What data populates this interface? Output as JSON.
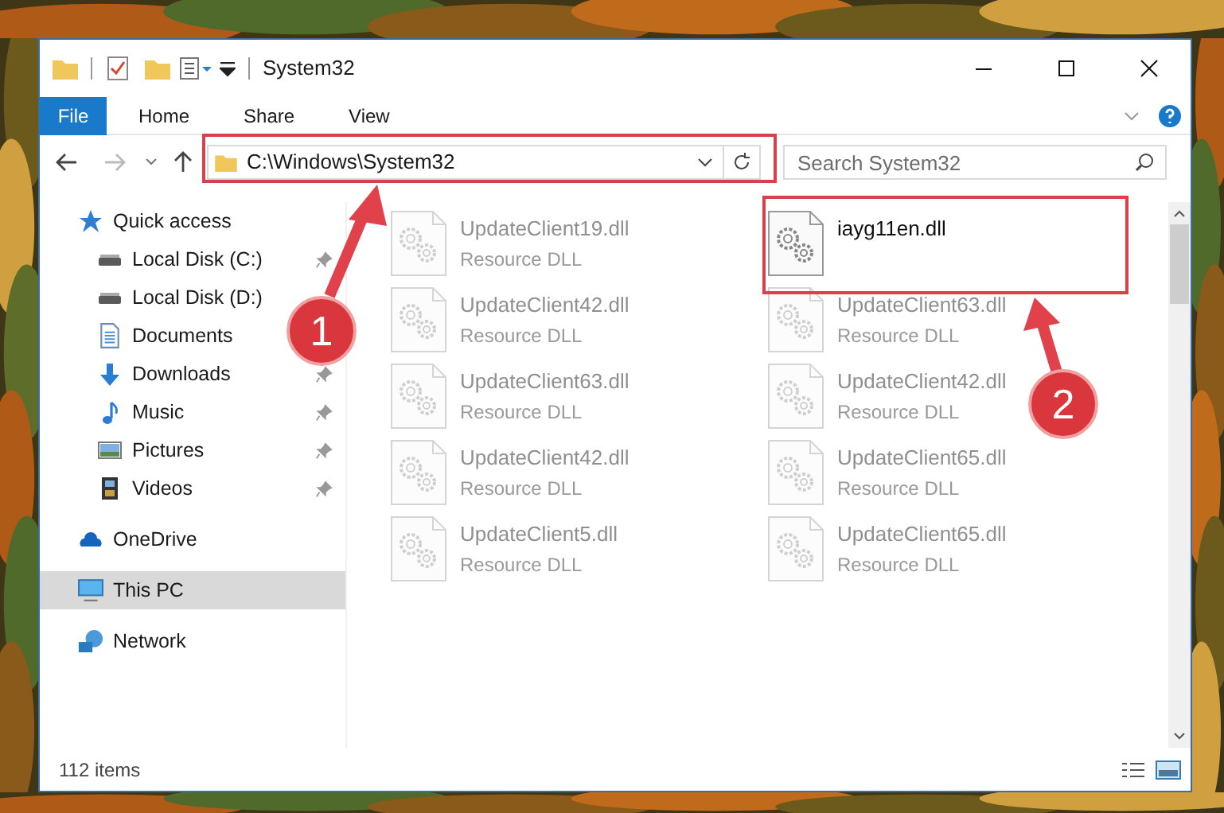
{
  "window": {
    "title": "System32"
  },
  "ribbon": {
    "file": "File",
    "tabs": [
      "Home",
      "Share",
      "View"
    ]
  },
  "address": {
    "path": "C:\\Windows\\System32"
  },
  "search": {
    "placeholder": "Search System32"
  },
  "nav": [
    {
      "label": "Quick access",
      "kind": "star",
      "selected": false,
      "children": [
        {
          "label": "Local Disk (C:)",
          "kind": "drive",
          "pinned": true,
          "selected": false
        },
        {
          "label": "Local Disk (D:)",
          "kind": "drive",
          "selected": false
        },
        {
          "label": "Documents",
          "kind": "documents",
          "selected": false
        },
        {
          "label": "Downloads",
          "kind": "downloads",
          "pinned": true,
          "selected": false
        },
        {
          "label": "Music",
          "kind": "music",
          "pinned": true,
          "selected": false
        },
        {
          "label": "Pictures",
          "kind": "pictures",
          "pinned": true,
          "selected": false
        },
        {
          "label": "Videos",
          "kind": "videos",
          "pinned": true,
          "selected": false
        }
      ]
    },
    {
      "label": "OneDrive",
      "kind": "cloud",
      "selected": false
    },
    {
      "label": "This PC",
      "kind": "pc",
      "selected": true
    },
    {
      "label": "Network",
      "kind": "network",
      "selected": false
    }
  ],
  "files": [
    {
      "name": "UpdateClient19.dll",
      "type": "Resource DLL",
      "blurred": true
    },
    {
      "name": "iayg11en.dll",
      "blurred": false
    },
    {
      "name": "UpdateClient42.dll",
      "type": "Resource DLL",
      "blurred": true
    },
    {
      "name": "UpdateClient63.dll",
      "type": "Resource DLL",
      "blurred": true
    },
    {
      "name": "UpdateClient63.dll",
      "type": "Resource DLL",
      "blurred": true
    },
    {
      "name": "UpdateClient42.dll",
      "type": "Resource DLL",
      "blurred": true
    },
    {
      "name": "UpdateClient42.dll",
      "type": "Resource DLL",
      "blurred": true
    },
    {
      "name": "UpdateClient65.dll",
      "type": "Resource DLL",
      "blurred": true
    },
    {
      "name": "UpdateClient5.dll",
      "type": "Resource DLL",
      "blurred": true
    },
    {
      "name": "UpdateClient65.dll",
      "type": "Resource DLL",
      "blurred": true
    }
  ],
  "status_bar": {
    "count": "112 items"
  },
  "annotations": [
    {
      "number": "1"
    },
    {
      "number": "2"
    }
  ]
}
